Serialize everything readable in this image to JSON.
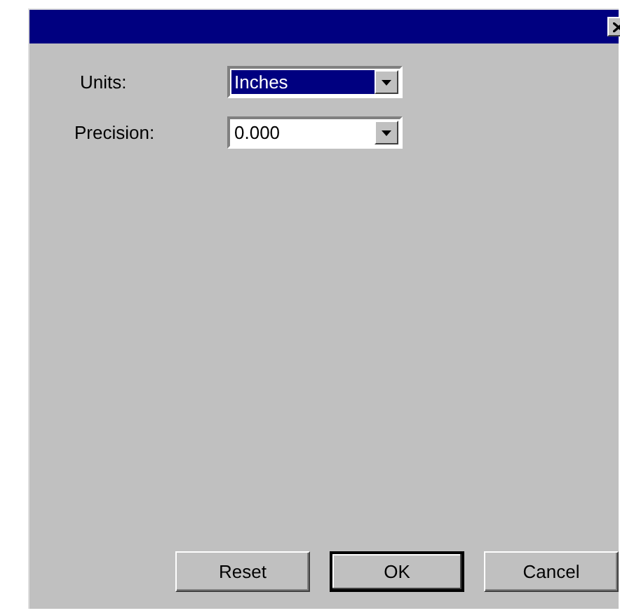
{
  "window": {
    "title_bar": true
  },
  "fields": [
    {
      "label": "Units:",
      "value": "Inches",
      "highlighted": true
    },
    {
      "label": "Precision:",
      "value": "0.000",
      "highlighted": false
    }
  ],
  "buttons": [
    {
      "label": "Reset",
      "default": false
    },
    {
      "label": "OK",
      "default": true
    },
    {
      "label": "Cancel",
      "default": false
    }
  ]
}
